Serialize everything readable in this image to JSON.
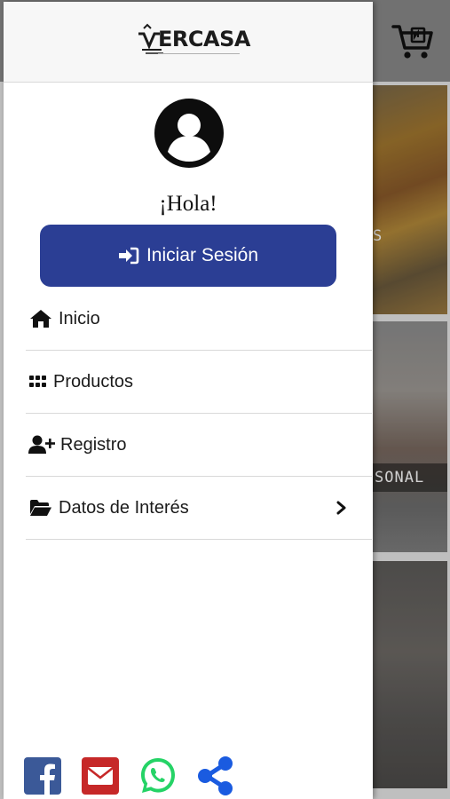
{
  "background": {
    "tile_captions": [
      "S",
      "SONAL"
    ]
  },
  "drawer": {
    "logo_text": "ERCASA",
    "greeting": "¡Hola!",
    "login_label": "Iniciar Sesión",
    "menu": [
      {
        "label": "Inicio",
        "icon": "home-icon"
      },
      {
        "label": "Productos",
        "icon": "grid-dots-icon"
      },
      {
        "label": "Registro",
        "icon": "user-plus-icon"
      },
      {
        "label": "Datos de Interés",
        "icon": "folder-open-icon",
        "has_submenu": true
      }
    ],
    "social": [
      "facebook-icon",
      "email-icon",
      "whatsapp-icon",
      "share-icon"
    ]
  },
  "colors": {
    "primary": "#2b3e94",
    "facebook": "#3b5998",
    "email": "#c62828",
    "whatsapp": "#25d366",
    "share": "#1a5be0"
  }
}
